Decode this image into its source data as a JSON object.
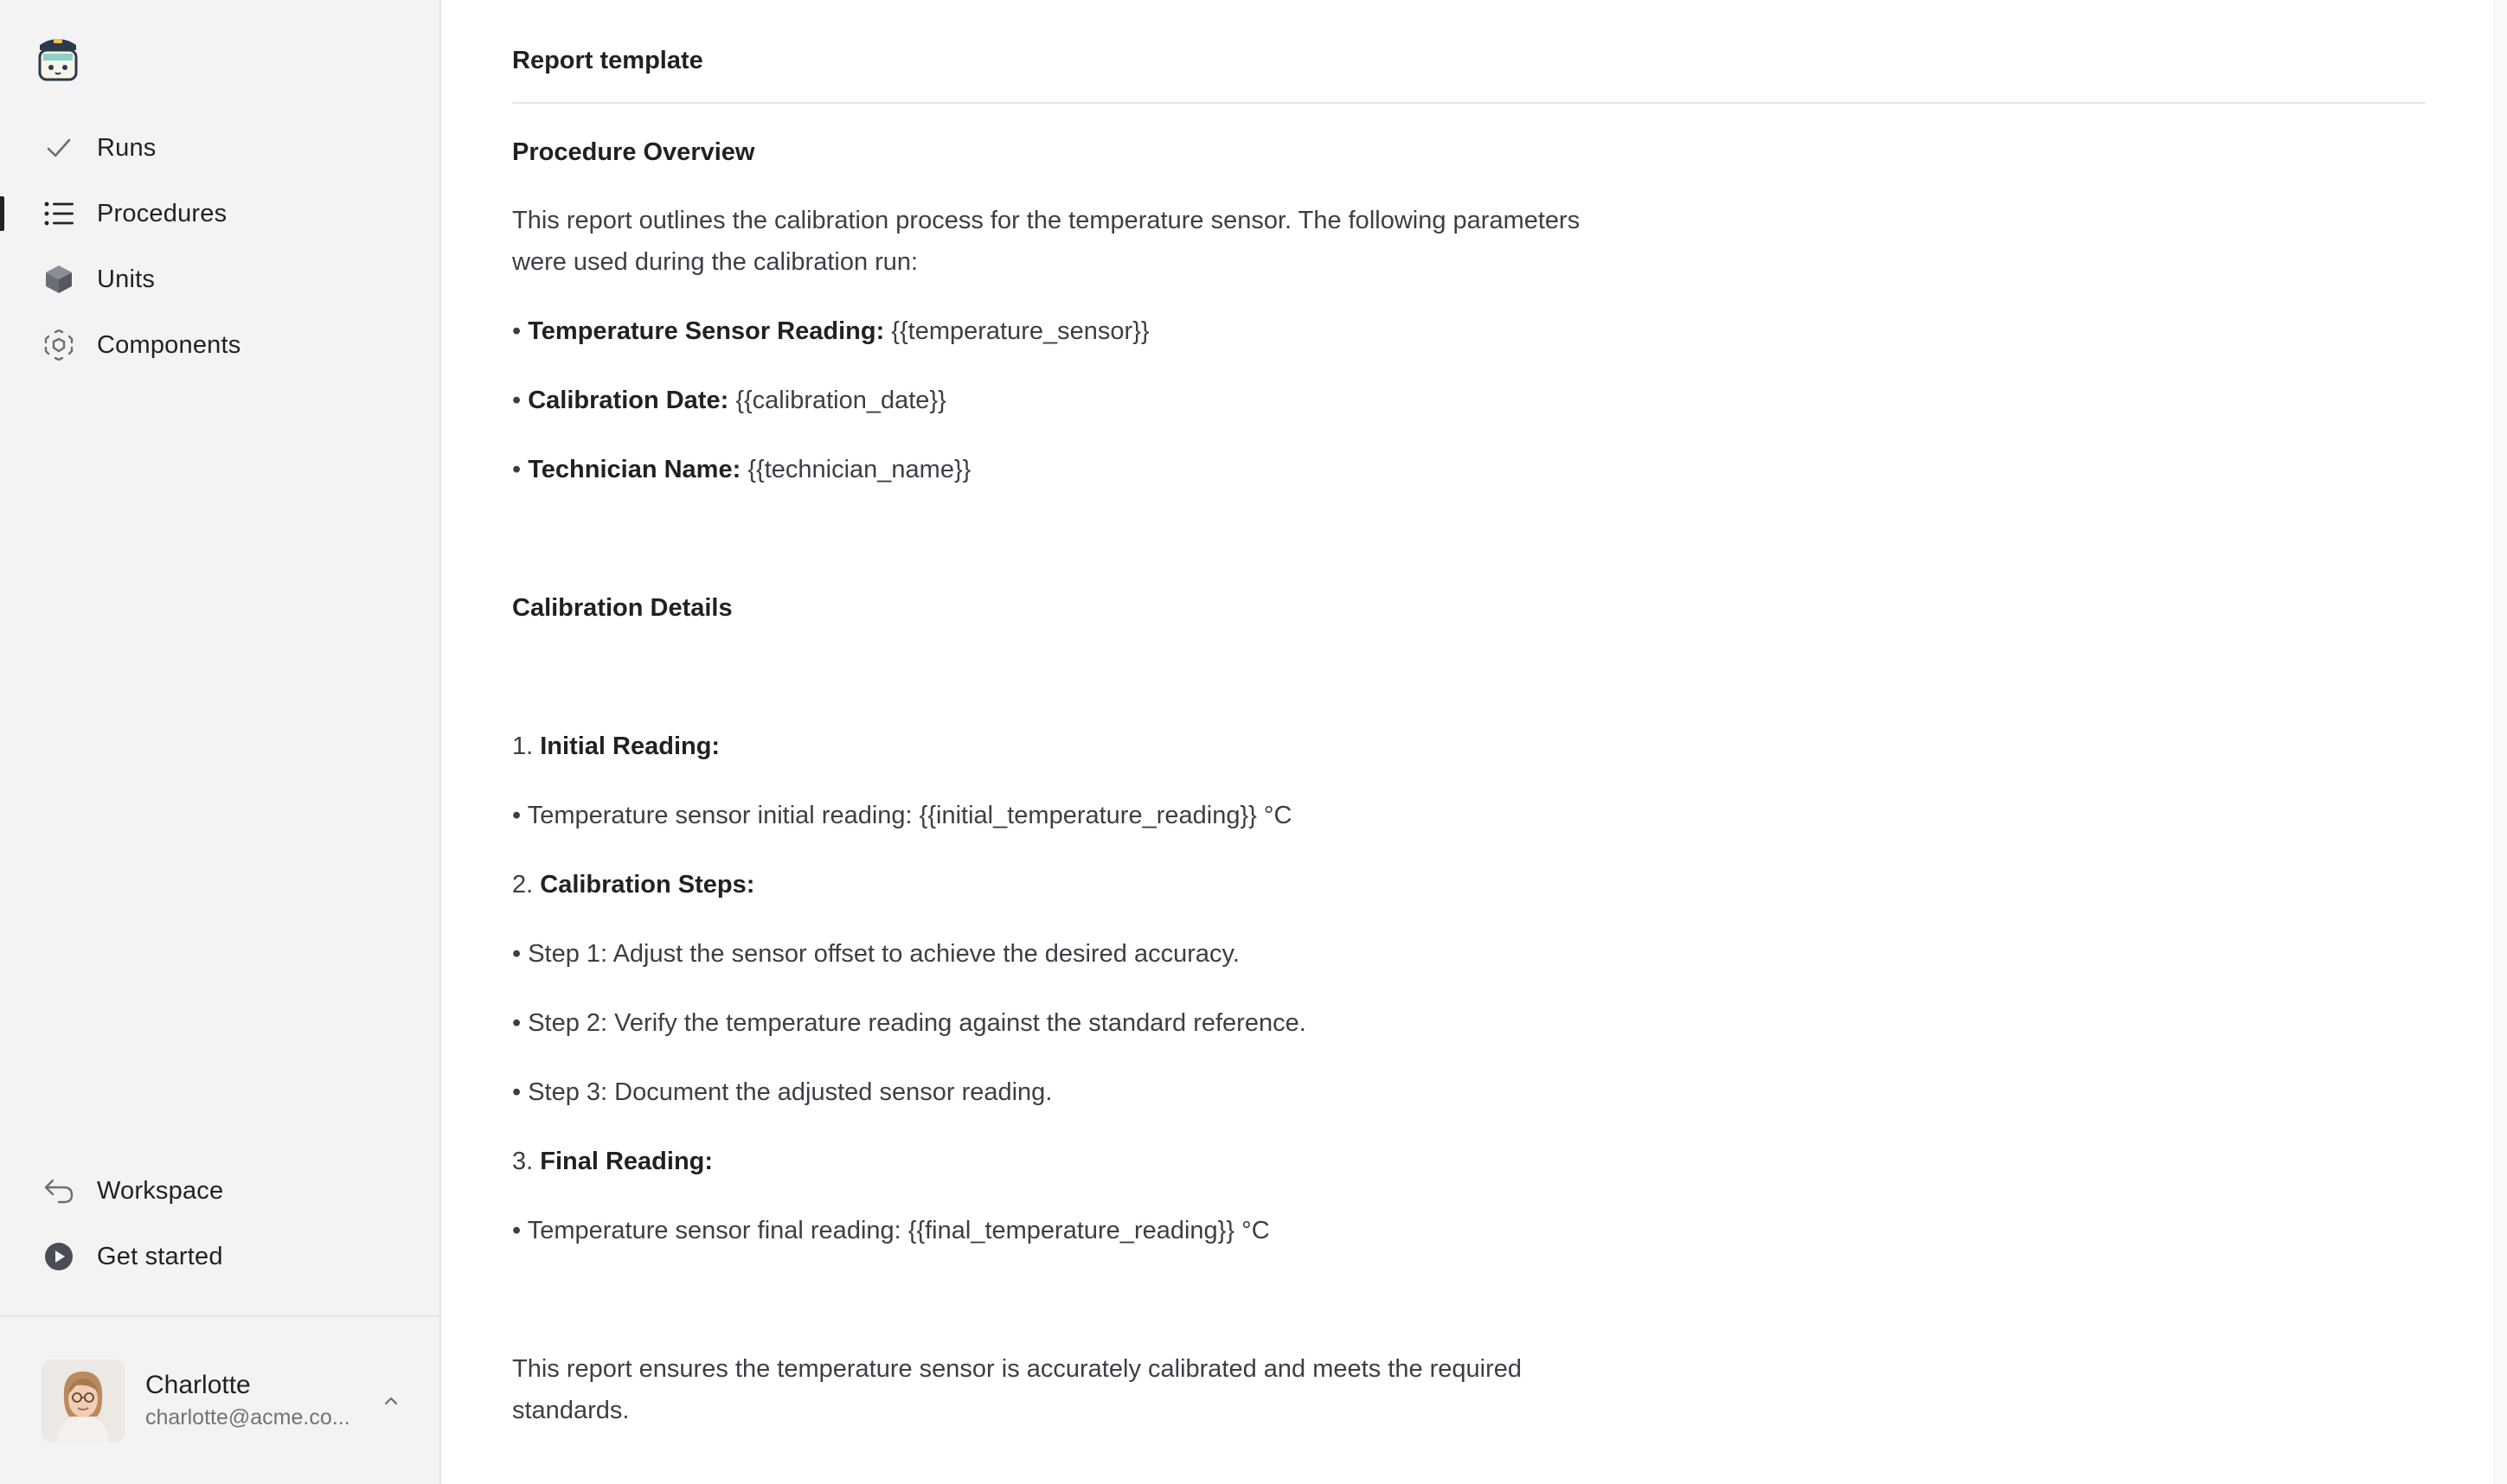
{
  "sidebar": {
    "nav": [
      {
        "label": "Runs",
        "icon": "check-icon"
      },
      {
        "label": "Procedures",
        "icon": "list-icon",
        "active": true
      },
      {
        "label": "Units",
        "icon": "cube-icon"
      },
      {
        "label": "Components",
        "icon": "components-icon"
      }
    ],
    "bottom": [
      {
        "label": "Workspace",
        "icon": "back-arrow-icon"
      },
      {
        "label": "Get started",
        "icon": "play-circle-icon"
      }
    ],
    "user": {
      "name": "Charlotte",
      "email": "charlotte@acme.co..."
    }
  },
  "main": {
    "title": "Report template",
    "overview": {
      "heading": "Procedure Overview",
      "intro_line1": "This report outlines the calibration process for the temperature sensor. The following parameters",
      "intro_line2": "were used during the calibration run:",
      "params": [
        {
          "label": "Temperature Sensor Reading:",
          "value": "{{temperature_sensor}}"
        },
        {
          "label": "Calibration Date:",
          "value": "{{calibration_date}}"
        },
        {
          "label": "Technician Name:",
          "value": "{{technician_name}}"
        }
      ]
    },
    "details": {
      "heading": "Calibration Details",
      "step1_num": "1.",
      "step1_label": "Initial Reading:",
      "step1_bullet": "Temperature sensor initial reading: {{initial_temperature_reading}} °C",
      "step2_num": "2.",
      "step2_label": "Calibration Steps:",
      "step2_bullets": [
        "Step 1: Adjust the sensor offset to achieve the desired accuracy.",
        "Step 2: Verify the temperature reading against the standard reference.",
        "Step 3: Document the adjusted sensor reading."
      ],
      "step3_num": "3.",
      "step3_label": "Final Reading:",
      "step3_bullet": "Temperature sensor final reading: {{final_temperature_reading}} °C"
    },
    "closing_line1": "This report ensures the temperature sensor is accurately calibrated and meets the required",
    "closing_line2": "standards."
  },
  "colors": {
    "sidebar_bg": "#f3f3f3",
    "text_primary": "#1f2124",
    "text_body": "#3b3f45",
    "text_muted": "#707479",
    "divider": "#e6e6e6"
  }
}
